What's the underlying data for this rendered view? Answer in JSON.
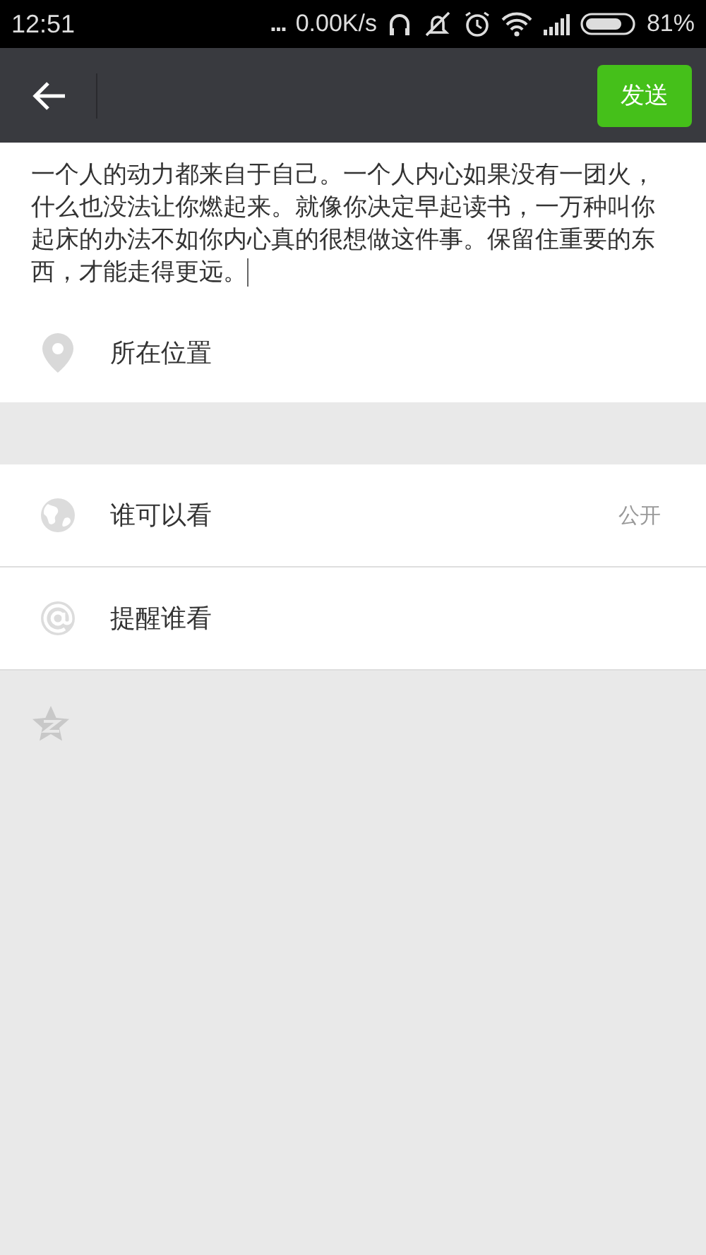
{
  "status_bar": {
    "time": "12:51",
    "dots": "...",
    "speed": "0.00K/s",
    "battery": "81%"
  },
  "toolbar": {
    "send": "发送"
  },
  "post": {
    "text": "一个人的动力都来自于自己。一个人内心如果没有一团火，什么也没法让你燃起来。就像你决定早起读书，一万种叫你起床的办法不如你内心真的很想做这件事。保留住重要的东西，才能走得更远。"
  },
  "location": {
    "label": "所在位置"
  },
  "options": [
    {
      "kind": "globe",
      "label": "谁可以看",
      "value": "公开"
    },
    {
      "kind": "at",
      "label": "提醒谁看"
    }
  ]
}
